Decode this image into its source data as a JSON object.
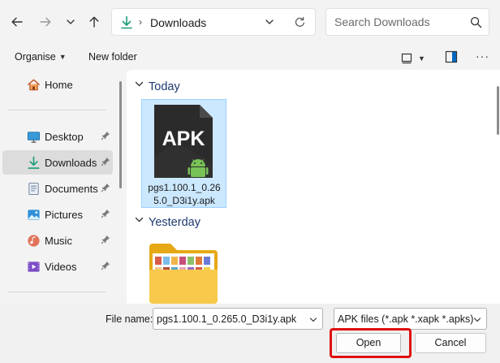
{
  "nav_buttons": {
    "back": "arrow-left-icon",
    "forward": "arrow-right-icon",
    "recent": "chevron-down-icon",
    "up": "arrow-up-icon"
  },
  "address": {
    "path": "Downloads",
    "separator": "›"
  },
  "search": {
    "placeholder": "Search Downloads"
  },
  "commandbar": {
    "organise_label": "Organise",
    "new_folder_label": "New folder",
    "more": "···"
  },
  "sidebar": {
    "items": [
      {
        "label": "Home",
        "icon": "home-icon",
        "pinned": false,
        "selected": false
      },
      {
        "label": "Desktop",
        "icon": "desktop-icon",
        "pinned": true,
        "selected": false
      },
      {
        "label": "Downloads",
        "icon": "download-icon",
        "pinned": true,
        "selected": true
      },
      {
        "label": "Documents",
        "icon": "document-icon",
        "pinned": true,
        "selected": false
      },
      {
        "label": "Pictures",
        "icon": "pictures-icon",
        "pinned": true,
        "selected": false
      },
      {
        "label": "Music",
        "icon": "music-icon",
        "pinned": true,
        "selected": false
      },
      {
        "label": "Videos",
        "icon": "videos-icon",
        "pinned": true,
        "selected": false
      }
    ]
  },
  "content": {
    "groups": [
      {
        "label": "Today"
      },
      {
        "label": "Yesterday"
      }
    ],
    "files": [
      {
        "name": "pgs1.100.1_0.265.0_D3i1y.apk",
        "thumb_text": "APK",
        "selected": true
      }
    ]
  },
  "footer": {
    "file_name_label": "File name:",
    "file_name_value": "pgs1.100.1_0.265.0_D3i1y.apk",
    "filter_value": "APK files (*.apk *.xapk *.apks)",
    "open_label": "Open",
    "cancel_label": "Cancel"
  },
  "colors": {
    "accent": "#0067c0",
    "selection_fill": "#cce8ff",
    "highlight_ring": "#e01010",
    "android_green": "#78c257",
    "folder_yellow": "#f3c140"
  }
}
